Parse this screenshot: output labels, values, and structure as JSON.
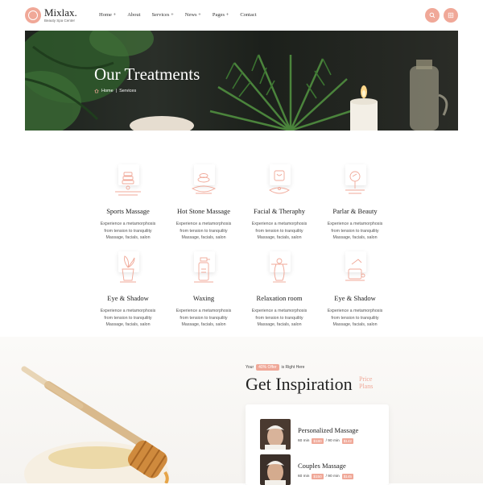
{
  "header": {
    "brand": "Mixlax.",
    "tagline": "Beauty Spa Center",
    "nav": [
      "Home +",
      "About",
      "Services +",
      "News +",
      "Pages +",
      "Contact"
    ],
    "search_icon": "search-icon",
    "menu_icon": "grid-menu-icon"
  },
  "hero": {
    "title": "Our Treatments",
    "breadcrumb": {
      "home": "Home",
      "separator": "|",
      "current": "Services"
    }
  },
  "treatments": [
    {
      "title": "Sports Massage",
      "desc1": "Experience a metamorphosis",
      "desc2": "from tension to tranquility",
      "desc3": "Massage, facials, salon",
      "icon": "massage-stones-icon"
    },
    {
      "title": "Hot Stone Massage",
      "desc1": "Experience a metamorphosis",
      "desc2": "from tension to tranquility",
      "desc3": "Massage, facials, salon",
      "icon": "hot-stone-icon"
    },
    {
      "title": "Facial & Theraphy",
      "desc1": "Experience a metamorphosis",
      "desc2": "from tension to tranquility",
      "desc3": "Massage, facials, salon",
      "icon": "facial-icon"
    },
    {
      "title": "Parlar & Beauty",
      "desc1": "Experience a metamorphosis",
      "desc2": "from tension to tranquility",
      "desc3": "Massage, facials, salon",
      "icon": "mirror-icon"
    },
    {
      "title": "Eye & Shadow",
      "desc1": "Experience a metamorphosis",
      "desc2": "from tension to tranquility",
      "desc3": "Massage, facials, salon",
      "icon": "plant-pot-icon"
    },
    {
      "title": "Waxing",
      "desc1": "Experience a metamorphosis",
      "desc2": "from tension to tranquility",
      "desc3": "Massage, facials, salon",
      "icon": "spray-bottle-icon"
    },
    {
      "title": "Relaxation room",
      "desc1": "Experience a metamorphosis",
      "desc2": "from tension to tranquility",
      "desc3": "Massage, facials, salon",
      "icon": "incense-icon"
    },
    {
      "title": "Eye & Shadow",
      "desc1": "Experience a metamorphosis",
      "desc2": "from tension to tranquility",
      "desc3": "Massage, facials, salon",
      "icon": "lotion-icon"
    }
  ],
  "inspiration": {
    "tag_prefix": "Your",
    "offer": "40% Offer",
    "tag_suffix": "is Right Here",
    "title": "Get Inspiration",
    "side_line1": "Price",
    "side_line2": "Plans",
    "plans": [
      {
        "name": "Personalized Massage",
        "t1": "60 min",
        "p1": "$180",
        "t2": "/ 90 min",
        "p2": "$142"
      },
      {
        "name": "Couples Massage",
        "t1": "60 min",
        "p1": "$150",
        "t2": "/ 90 min",
        "p2": "$145"
      }
    ]
  },
  "colors": {
    "accent": "#f0a898",
    "dark_text": "#222222"
  }
}
